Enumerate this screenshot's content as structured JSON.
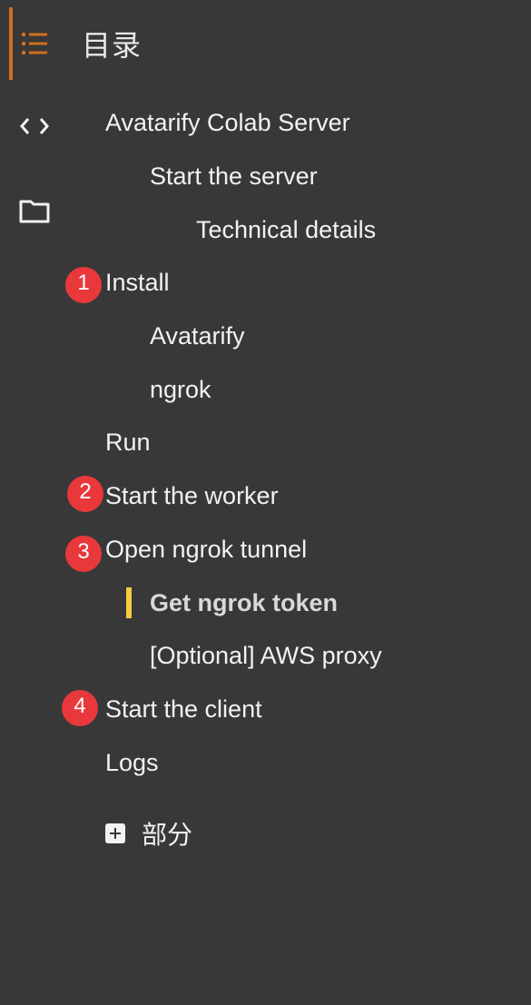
{
  "sidebar": {
    "title": "目录",
    "icons": {
      "toc": "toc-list-icon",
      "code": "code-brackets-icon",
      "files": "folder-icon"
    },
    "accent_color": "#d1701f"
  },
  "toc": {
    "items": [
      {
        "label": "Avatarify Colab Server",
        "level": 1
      },
      {
        "label": "Start the server",
        "level": 2
      },
      {
        "label": "Technical details",
        "level": 3
      },
      {
        "label": "Install",
        "level": 1
      },
      {
        "label": "Avatarify",
        "level": 2
      },
      {
        "label": "ngrok",
        "level": 2
      },
      {
        "label": "Run",
        "level": 1
      },
      {
        "label": "Start the worker",
        "level": 1
      },
      {
        "label": "Open ngrok tunnel",
        "level": 1
      },
      {
        "label": "Get ngrok token",
        "level": 2,
        "active": true
      },
      {
        "label": "[Optional] AWS proxy",
        "level": 2
      },
      {
        "label": "Start the client",
        "level": 1
      },
      {
        "label": "Logs",
        "level": 1
      }
    ],
    "active_marker_color": "#f6cc3c",
    "add_section_label": "部分"
  },
  "annotations": {
    "badges": [
      "1",
      "2",
      "3",
      "4"
    ],
    "badge_color": "#e8383b"
  }
}
